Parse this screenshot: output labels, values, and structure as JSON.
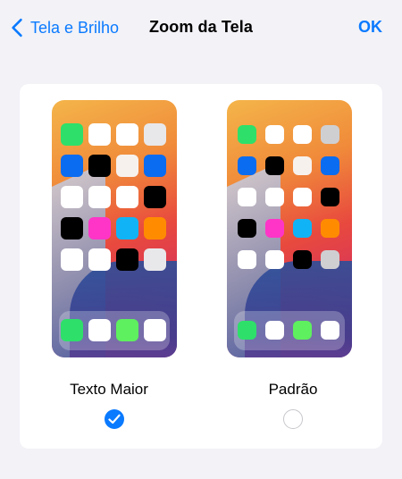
{
  "nav": {
    "back_label": "Tela e Brilho",
    "title": "Zoom da Tela",
    "done_label": "OK",
    "accent": "#0a7aff"
  },
  "options": [
    {
      "label": "Texto Maior",
      "selected": true,
      "rows": [
        [
          "#2ee06a",
          "#ffffff",
          "#ffffff",
          "#e8e8ea"
        ],
        [
          "#0a6cf0",
          "#000000",
          "#f7f1ee",
          "#0a6cf0"
        ],
        [
          "#ffffff",
          "#ffffff",
          "#ffffff",
          "#000000"
        ],
        [
          "#000000",
          "#ff35c8",
          "#10b4f6",
          "#ff8c00"
        ],
        [
          "#ffffff",
          "#ffffff",
          "#000000",
          "#e8e8ea"
        ]
      ],
      "dock": [
        "#2ee06a",
        "#ffffff",
        "#5ef05e",
        "#ffffff"
      ]
    },
    {
      "label": "Padrão",
      "selected": false,
      "rows": [
        [
          "#2ee06a",
          "#ffffff",
          "#ffffff",
          "#cfcfd2"
        ],
        [
          "#0a6cf0",
          "#000000",
          "#f7f1ee",
          "#0a6cf0"
        ],
        [
          "#ffffff",
          "#ffffff",
          "#ffffff",
          "#000000"
        ],
        [
          "#000000",
          "#ff35c8",
          "#10b4f6",
          "#ff8c00"
        ],
        [
          "#ffffff",
          "#ffffff",
          "#000000",
          "#cfcfd2"
        ]
      ],
      "dock": [
        "#2ee06a",
        "#ffffff",
        "#5ef05e",
        "#ffffff"
      ]
    }
  ]
}
